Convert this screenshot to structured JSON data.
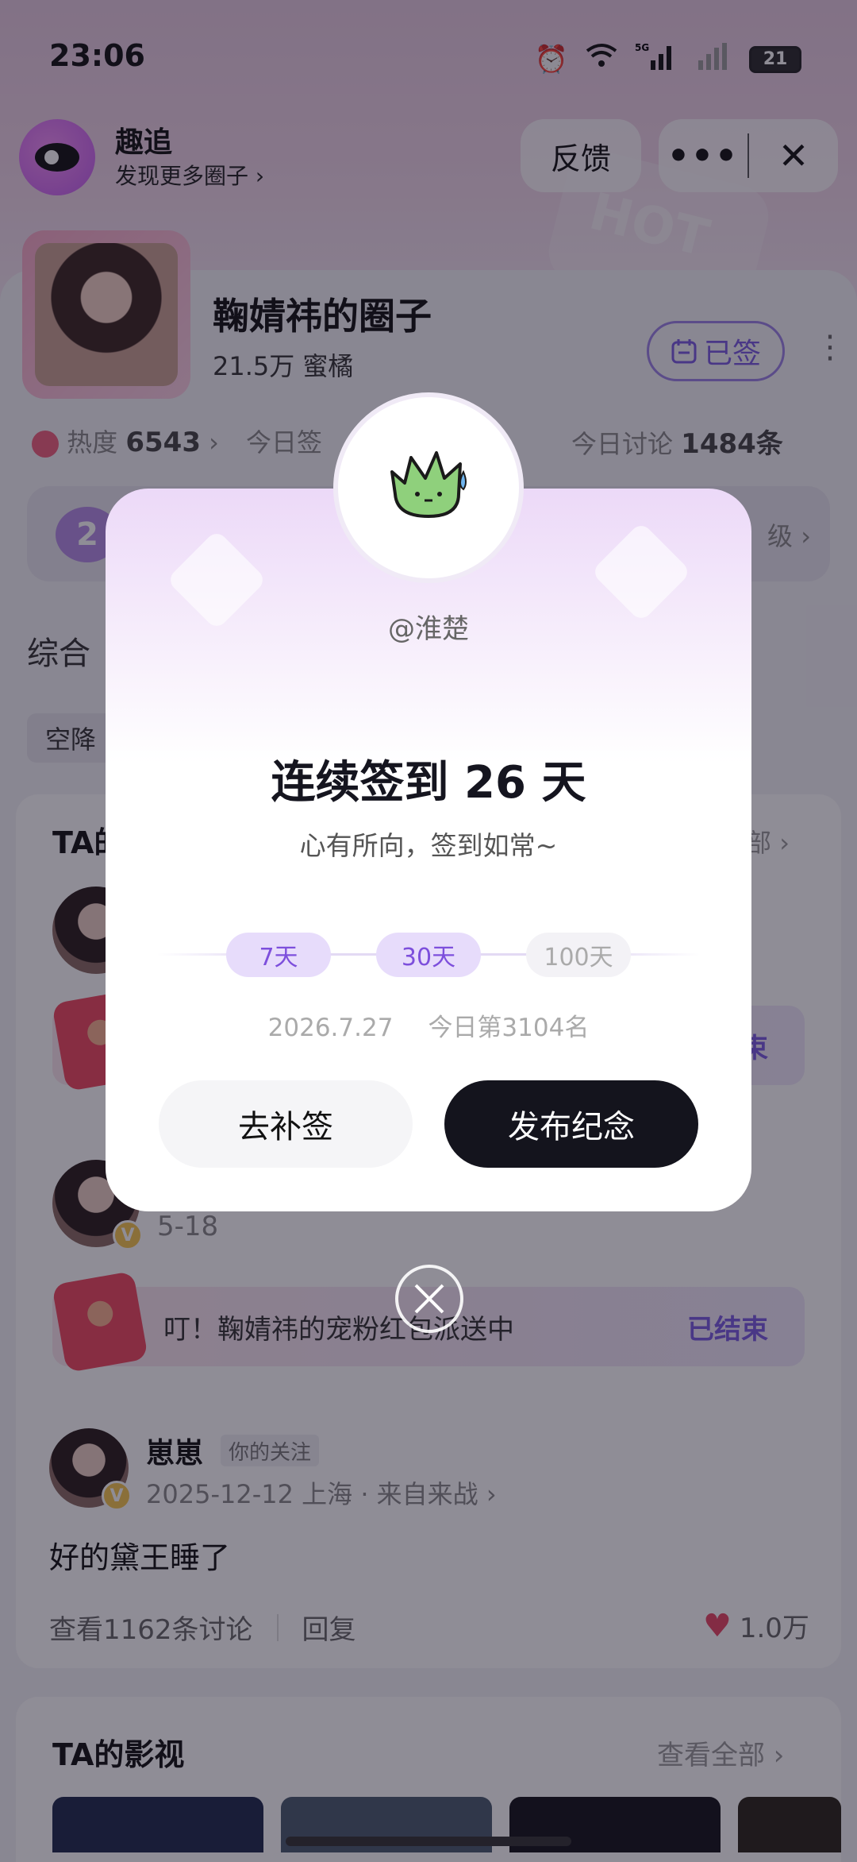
{
  "status_bar": {
    "time": "23:06",
    "network": "5G",
    "battery": "21"
  },
  "app_bar": {
    "name": "趣追",
    "subtitle": "发现更多圈子",
    "feedback_label": "反馈",
    "more_label": "•••",
    "close_label": "✕"
  },
  "circle": {
    "name": "鞠婧祎的圈子",
    "fans": "21.5万 蜜橘",
    "signed_label": "已签",
    "heat_label": "热度",
    "heat_value": "6543",
    "today_sign_label": "今日签",
    "today_discuss_label": "今日讨论",
    "today_discuss_value": "1484条",
    "level_left": "2",
    "level_right": "级"
  },
  "tabs": {
    "first": "综合"
  },
  "chips": {
    "first": "空降"
  },
  "feed": {
    "section_title": "TA的",
    "section_more": "部",
    "redpacket_text": "叮！鞠婧祎的宠粉红包派送中",
    "redpacket_status": "已结束",
    "redpacket_status_partial": "束",
    "second_post_date": "5-18",
    "author": "崽崽",
    "follow_tag": "你的关注",
    "post_meta": "2025-12-12 上海 · 来自来战",
    "post_text": "好的黛王睡了",
    "view_discussions": "查看1162条讨论",
    "reply": "回复",
    "likes": "1.0万"
  },
  "films": {
    "title": "TA的影视",
    "more": "查看全部"
  },
  "dialog": {
    "handle": "@淮楚",
    "title": "连续签到 26 天",
    "subtitle": "心有所向，签到如常~",
    "milestones": [
      {
        "label": "7天",
        "achieved": true
      },
      {
        "label": "30天",
        "achieved": true
      },
      {
        "label": "100天",
        "achieved": false
      }
    ],
    "date": "2026.7.27",
    "rank": "今日第3104名",
    "makeup_label": "去补签",
    "publish_label": "发布纪念"
  },
  "icons": {
    "alarm": "alarm-icon",
    "wifi": "wifi-icon",
    "signal": "signal-icon",
    "calendar": "calendar-icon",
    "mascot": "mascot-icon",
    "close": "close-icon",
    "heart": "heart-icon"
  },
  "colors": {
    "accent": "#7d4fdc",
    "dark_button": "#14141d",
    "like": "#e94663"
  }
}
